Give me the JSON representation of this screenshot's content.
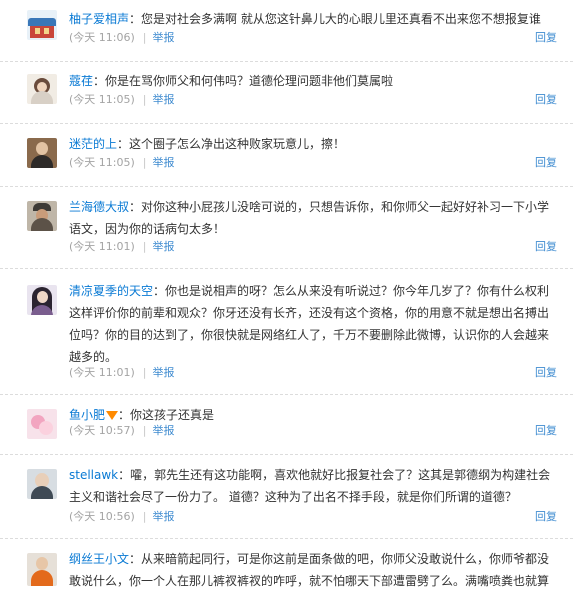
{
  "comments": [
    {
      "user": "柚子爱相声",
      "text": "：您是对社会多满啊   就从您这针鼻儿大的心眼儿里还真看不出来您不想报复谁",
      "time": "(今天 11:06)",
      "report": "举报",
      "reply": "回复"
    },
    {
      "user": "蔻荏",
      "text": "：你是在骂你师父和何伟吗？道德伦理问题非他们莫属啦",
      "time": "(今天 11:05)",
      "report": "举报",
      "reply": "回复"
    },
    {
      "user": "迷茫的上",
      "text": "：这个圈子怎么净出这种败家玩意儿，擦！",
      "time": "(今天 11:05)",
      "report": "举报",
      "reply": "回复"
    },
    {
      "user": "兰海德大叔",
      "text": "：对你这种小屁孩儿没啥可说的，只想告诉你，和你师父一起好好补习一下小学语文，因为你的话病句太多！",
      "time": "(今天 11:01)",
      "report": "举报",
      "reply": "回复"
    },
    {
      "user": "清凉夏季的天空",
      "text": "：你也是说相声的呀？怎么从来没有听说过？你今年几岁了？你有什么权利这样评价你的前辈和观众？你牙还没有长齐，还没有这个资格，你的用意不就是想出名搏出位吗？你的目的达到了，你很快就是网络红人了，千万不要删除此微博，认识你的人会越来越多的。",
      "time": "(今天 11:01)",
      "report": "举报",
      "reply": "回复"
    },
    {
      "user": "鱼小肥",
      "text": "：你这孩子还真是",
      "time": "(今天 10:57)",
      "report": "举报",
      "reply": "回复"
    },
    {
      "user": "stellawk",
      "text": "：嚯，郭先生还有这功能啊，喜欢他就好比报复社会了？这其是郭德纲为构建社会主义和谐社会尽了一份力了。 道德？这种为了出名不择手段，就是你们所谓的道德？",
      "time": "(今天 10:56)",
      "report": "举报",
      "reply": "回复"
    },
    {
      "user": "纲丝王小文",
      "text": "：从来暗箭起同行，可是你这前是面条做的吧，你师父没敢说什么，你师爷都没敢说什么，你一个人在那儿裤衩裤衩的咋呼，就不怕哪天下部遭雷劈了么。满嘴喷粪也就算",
      "time": "",
      "report": "",
      "reply": ""
    }
  ],
  "colors": {
    "username": "#0a7ad4",
    "link": "#3e8bd0",
    "muted": "#a4a4a4",
    "divider": "#dcdcdc",
    "badge": "#ff8a00"
  }
}
